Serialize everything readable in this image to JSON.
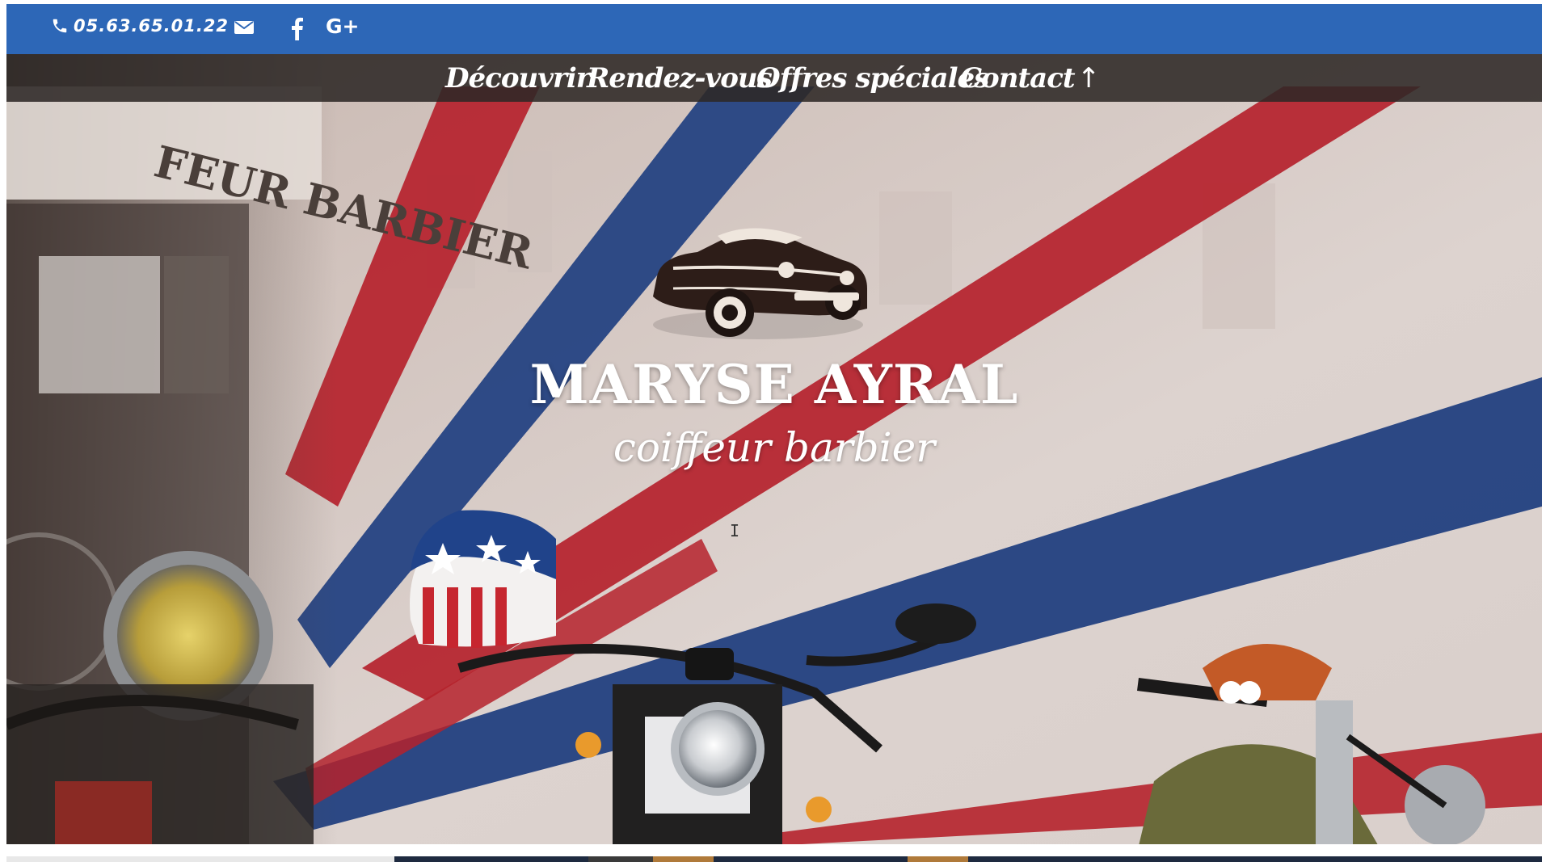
{
  "topbar": {
    "phone": "05.63.65.01.22",
    "social": [
      "email-icon",
      "facebook-icon",
      "google-plus-icon"
    ],
    "google_plus_label": "G+"
  },
  "nav": {
    "items": [
      "Découvrir",
      "Rendez-vous",
      "Offres spéciales",
      "Contact"
    ],
    "back_to_top": "↑"
  },
  "hero": {
    "title": "MARYSE AYRAL",
    "subtitle": "coiffeur barbier",
    "bg_sign": "FEUR BARBIER"
  },
  "colors": {
    "topbar": "#2d67b7",
    "nav_bg": "#2d2826",
    "stripe_red": "#b7262f",
    "stripe_blue": "#24417d"
  }
}
